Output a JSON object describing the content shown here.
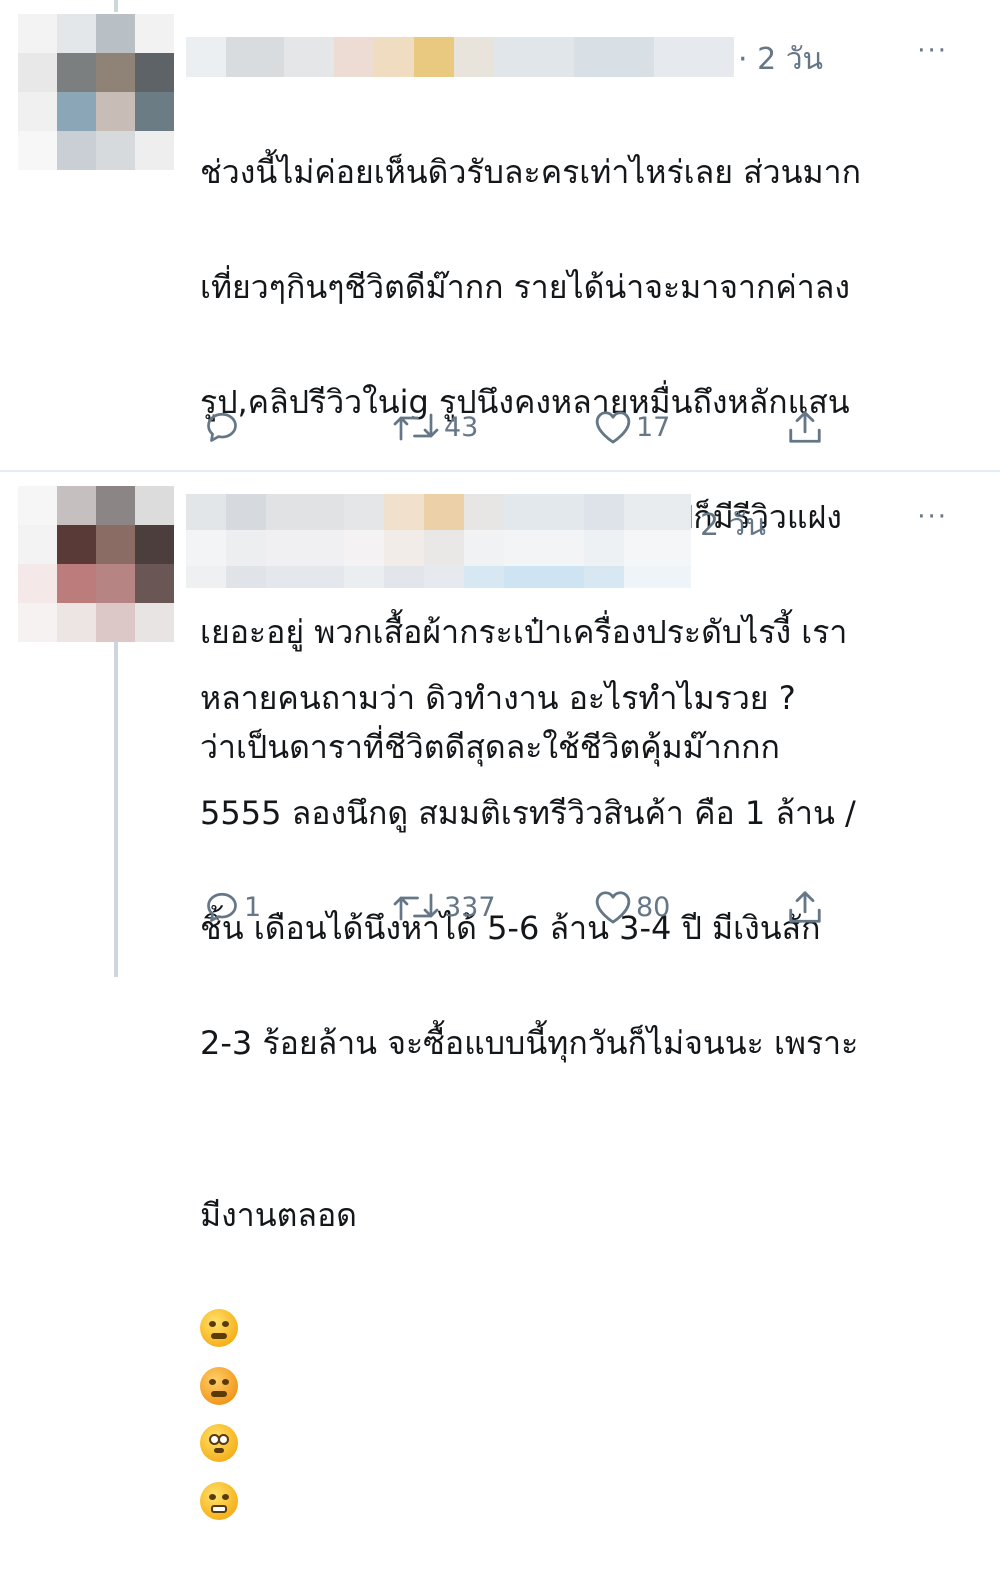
{
  "tweets": [
    {
      "time": "· 2 วัน",
      "more": "···",
      "lines": [
        "ช่วงนี้ไม่ค่อยเห็นดิวรับละครเท่าไหร่เลย ส่วนมาก",
        "เที่ยวๆกินๆชีวิตดีม๊ากก รายได้น่าจะมาจากค่าลง",
        "รูป,คลิปรีวิวในig รูปนึงคงหลายหมื่นถึงหลักแสน",
        "บางรูปดูเผินๆเหมือนรูปไปเที่ยวทั่วไปก็มีรีวิวแฝง",
        "เยอะอยู่ พวกเสื้อผ้ากระเป๋าเครื่องประดับไรงี้ เรา",
        "ว่าเป็นดาราที่ชีวิตดีสุดละใช้ชีวิตคุ้มม๊ากกก"
      ],
      "actions": {
        "reply_count": "",
        "retweet_count": "43",
        "like_count": "17"
      }
    },
    {
      "time": "2 วัน",
      "more": "···",
      "lines": [
        "หลายคนถามว่า ดิวทำงาน อะไรทำไมรวย ?",
        "5555 ลองนึกดู สมมติเรทรีวิวสินค้า คือ 1 ล้าน /",
        "ชิ้น เดือนได้นึงหาได้ 5-6 ล้าน 3-4 ปี มีเงินสัก",
        "2-3 ร้อยล้าน จะซื้อแบบนี้ทุกวันก็ไม่จนนะ เพราะ",
        "มีงานตลอด"
      ],
      "emojis": [
        "weary-face-emoji",
        "angry-face-emoji",
        "flushed-face-emoji",
        "steam-from-nose-emoji"
      ],
      "actions": {
        "reply_count": "1",
        "retweet_count": "337",
        "like_count": "80"
      }
    }
  ],
  "icons": {
    "reply": "reply-icon",
    "retweet": "retweet-icon",
    "like": "heart-icon",
    "share": "share-icon"
  },
  "colors": {
    "text": "#14171a",
    "secondary": "#657786",
    "divider": "#e6ecf0",
    "thread_line": "#ccd6dd"
  }
}
